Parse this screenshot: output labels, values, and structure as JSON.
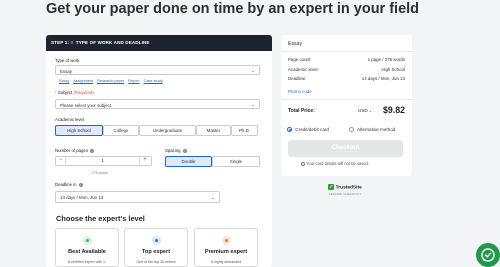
{
  "page_title": "Get your paper done on time by an expert in your field",
  "step": {
    "label": "STEP 1:",
    "count": "3",
    "title": "TYPE OF WORK AND DEADLINE"
  },
  "type_of_work": {
    "label": "Type of work",
    "value": "Essay",
    "quick_links": [
      "Essay",
      "Assignment",
      "Research paper",
      "Report",
      "Case study"
    ]
  },
  "subject": {
    "label": "Subject",
    "required": "(Required)",
    "placeholder": "Please select your subject"
  },
  "academic_level": {
    "label": "Academic level",
    "options": [
      "High School",
      "College",
      "Undergraduate",
      "Master",
      "Ph.D."
    ],
    "selected": "High School"
  },
  "pages": {
    "label": "Number of pages",
    "minus": "−",
    "value": "1",
    "plus": "+",
    "words": "275 words"
  },
  "spacing": {
    "label": "Spacing",
    "options": [
      "Double",
      "Single"
    ],
    "selected": "Double"
  },
  "deadline": {
    "label": "Deadline in",
    "value": "14 days / Mon, Jun 13"
  },
  "experts": {
    "title": "Choose the expert's level",
    "cards": [
      {
        "name": "Best Available",
        "desc": "A certified expert with 1-",
        "color": "#3fb35a"
      },
      {
        "name": "Top expert",
        "desc": "One of the top 30 writers",
        "color": "#2f6fe0"
      },
      {
        "name": "Premium expert",
        "desc": "A highly demanded",
        "color": "#f07a2a"
      }
    ]
  },
  "summary": {
    "title": "Essay",
    "rows": [
      {
        "label": "Page count:",
        "value": "1 page / 275 words"
      },
      {
        "label": "Academic level:",
        "value": "High School"
      },
      {
        "label": "Deadline:",
        "value": "14 days / Mon, Jun 13"
      }
    ],
    "promo": "Promo code",
    "total_label": "Total Price:",
    "currency": "USD",
    "price": "$9.82",
    "payment_options": [
      "Credit/debit card",
      "Alternative method"
    ],
    "checkout": "Checkout",
    "secure_note": "Your card details will not be saved."
  },
  "trust": {
    "name": "TrustedSite",
    "sub": "SECURE CHECKOUT"
  },
  "colors": {
    "accent": "#1a67d2",
    "header_dark": "#1d2430",
    "chat_green": "#1f9a4a"
  }
}
